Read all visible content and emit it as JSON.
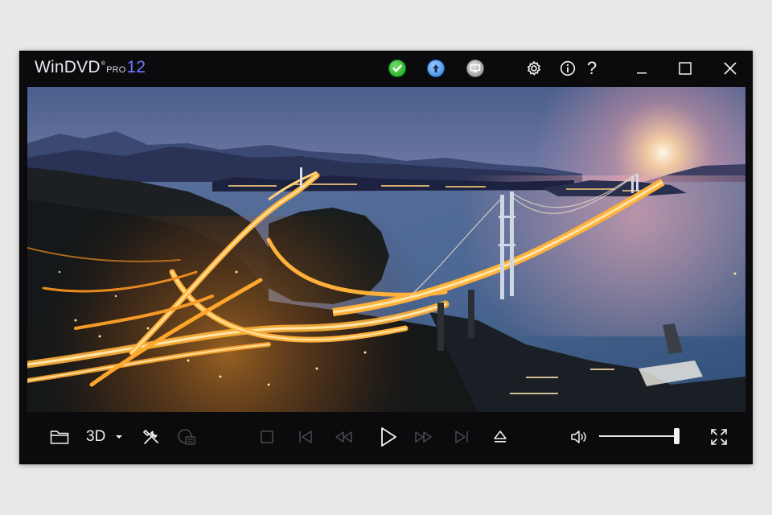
{
  "app": {
    "name": "WinDVD",
    "edition": "PRO",
    "version": "12"
  },
  "title_bar": {
    "status_icons": [
      "check-circle-icon",
      "upload-circle-icon",
      "display-circle-icon"
    ],
    "buttons": [
      "settings",
      "info",
      "help",
      "minimize",
      "maximize",
      "close"
    ],
    "help_label": "?"
  },
  "video": {
    "scene": "aerial city bridge at dusk"
  },
  "controls": {
    "threed_label": "3D",
    "volume_level": 1.0,
    "buttons": [
      "open-folder",
      "3d-mode",
      "tools",
      "display-mode",
      "stop",
      "previous-chapter",
      "rewind",
      "play",
      "fast-forward",
      "next-chapter",
      "eject",
      "volume",
      "fullscreen"
    ]
  },
  "colors": {
    "window_bg": "#0b0b0d",
    "accent_version": "#6f7bff",
    "icon_active": "#f2f2f2",
    "icon_disabled": "#4a4a4e"
  }
}
